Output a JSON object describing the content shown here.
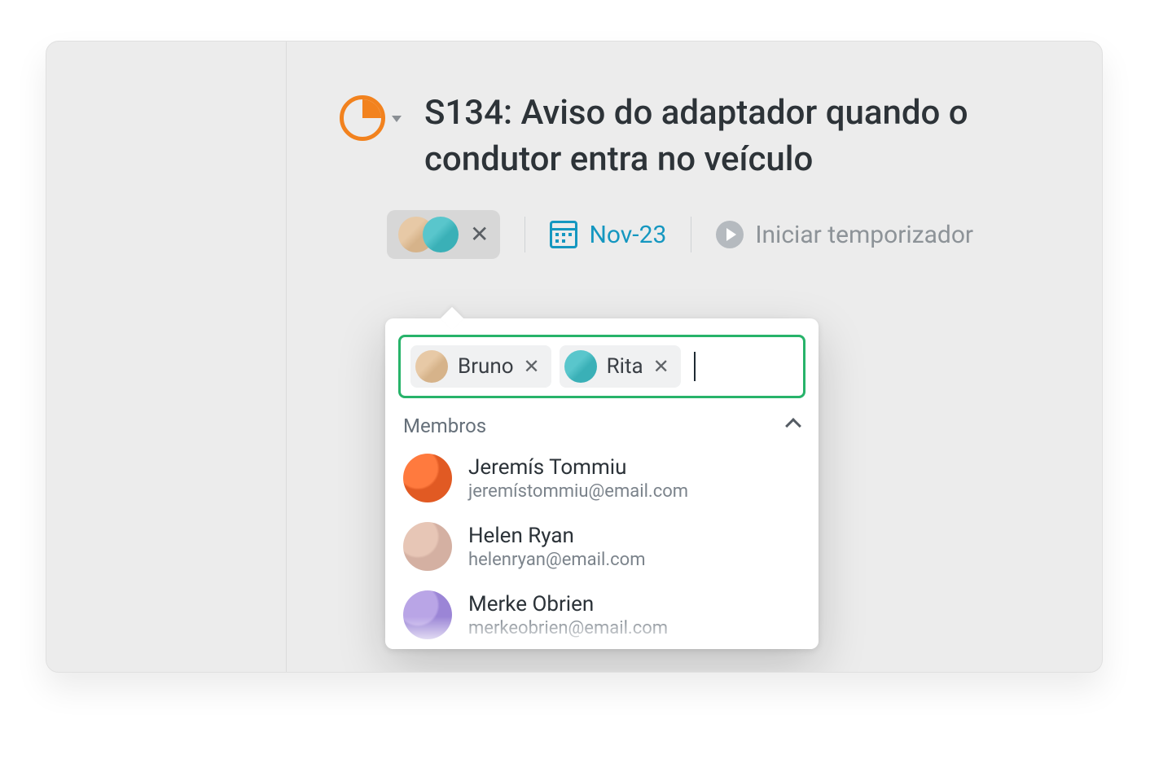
{
  "task": {
    "title": "S134: Aviso do adaptador quando o condutor entra no veículo",
    "status_icon": "quarter-pie-icon"
  },
  "meta": {
    "date_label": "Nov-23",
    "timer_label": "Iniciar temporizador"
  },
  "assignees_chip": {
    "avatars": [
      "bruno",
      "rita"
    ]
  },
  "popover": {
    "tokens": [
      {
        "name": "Bruno",
        "avatar": "bruno"
      },
      {
        "name": "Rita",
        "avatar": "rita"
      }
    ],
    "section_label": "Membros",
    "members": [
      {
        "name": "Jeremís Tommiu",
        "email": "jeremístommiu@email.com",
        "avatar": "m1"
      },
      {
        "name": "Helen Ryan",
        "email": "helenryan@email.com",
        "avatar": "m2"
      },
      {
        "name": "Merke Obrien",
        "email": "merkeobrien@email.com",
        "avatar": "m3"
      }
    ]
  }
}
